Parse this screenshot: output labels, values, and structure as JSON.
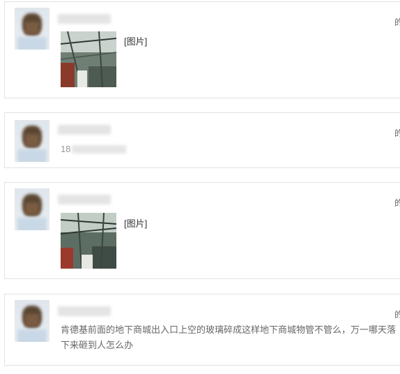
{
  "posts": [
    {
      "corner_text": "的",
      "avatar_icon": "user-avatar-icon",
      "image_label": "[图片]"
    },
    {
      "corner_text": "的",
      "avatar_icon": "user-avatar-icon",
      "phone_prefix": "18"
    },
    {
      "corner_text": "的",
      "avatar_icon": "user-avatar-icon",
      "image_label": "[图片]"
    },
    {
      "corner_text": "的",
      "avatar_icon": "user-avatar-icon",
      "message": "肯德基前面的地下商城出入口上空的玻璃碎成这样地下商城物管不管么，万一哪天落下来砸到人怎么办"
    }
  ]
}
